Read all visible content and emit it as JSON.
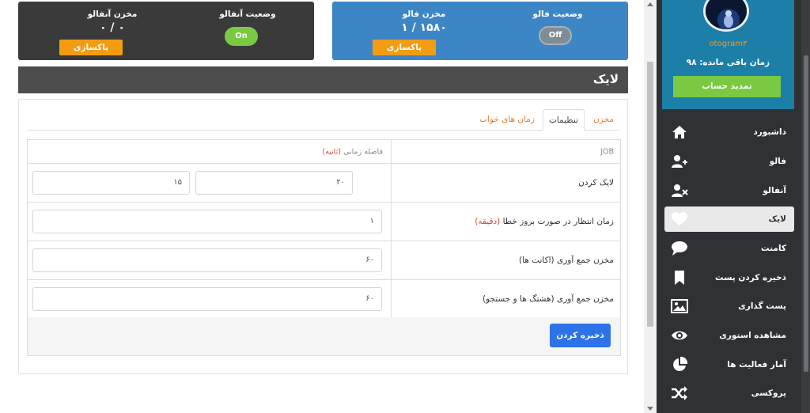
{
  "cards": {
    "unfollow": {
      "storage_label": "مخزن آنفالو",
      "storage_value": "۰ / ۰",
      "status_label": "وضعیت آنفالو",
      "toggle": "On",
      "clear_button": "پاکسازی مخزن"
    },
    "follow": {
      "storage_label": "مخزن فالو",
      "storage_value": "۱ / ۱۵۸۰",
      "status_label": "وضعیت فالو",
      "toggle": "Off",
      "clear_button": "پاکسازی مخزن"
    }
  },
  "section": {
    "title": "لایک"
  },
  "tabs": [
    {
      "label": "مخزن",
      "active": false
    },
    {
      "label": "تنظیمات",
      "active": true
    },
    {
      "label": "زمان های خواب",
      "active": false
    }
  ],
  "table": {
    "header": {
      "job": "JOB",
      "interval_prefix": "فاصله زمانی",
      "interval_unit": "(ثانیه)"
    },
    "rows": [
      {
        "label": "لایک کردن",
        "unit": "",
        "values": [
          "۲۰",
          "۱۵"
        ]
      },
      {
        "label": "زمان انتظار در صورت بروز خطا",
        "unit": "(دقیقه)",
        "values": [
          "۱"
        ]
      },
      {
        "label": "مخزن جمع آوری (اکانت ها)",
        "unit": "",
        "values": [
          "۶۰"
        ]
      },
      {
        "label": "مخزن جمع آوری (هشتگ ها و جستجو)",
        "unit": "",
        "values": [
          "۶۰"
        ]
      }
    ],
    "save_button": "ذخیره کردن"
  },
  "sidebar": {
    "username": "otogram۳",
    "remaining": "زمان باقی مانده: ۹۸",
    "renew_button": "تمدید حساب",
    "items": [
      {
        "label": "داشبورد",
        "icon": "home-icon",
        "active": false
      },
      {
        "label": "فالو",
        "icon": "user-plus-icon",
        "active": false
      },
      {
        "label": "آنفالو",
        "icon": "user-remove-icon",
        "active": false
      },
      {
        "label": "لایک",
        "icon": "heart-icon",
        "active": true
      },
      {
        "label": "کامنت",
        "icon": "comment-icon",
        "active": false
      },
      {
        "label": "ذخیره کردن پست",
        "icon": "bookmark-icon",
        "active": false
      },
      {
        "label": "پست گذاری",
        "icon": "image-icon",
        "active": false
      },
      {
        "label": "مشاهده استوری",
        "icon": "eye-icon",
        "active": false
      },
      {
        "label": "آمار فعالیت ها",
        "icon": "pie-chart-icon",
        "active": false
      },
      {
        "label": "پروکسی",
        "icon": "shuffle-icon",
        "active": false
      }
    ]
  },
  "colors": {
    "follow_card": "#3d86c6",
    "unfollow_card": "#3a3a3a",
    "orange": "#f39c12",
    "green": "#7ac943",
    "primary": "#2d72e6",
    "sidebar": "#2f3135",
    "profile": "#1c7fa8"
  }
}
